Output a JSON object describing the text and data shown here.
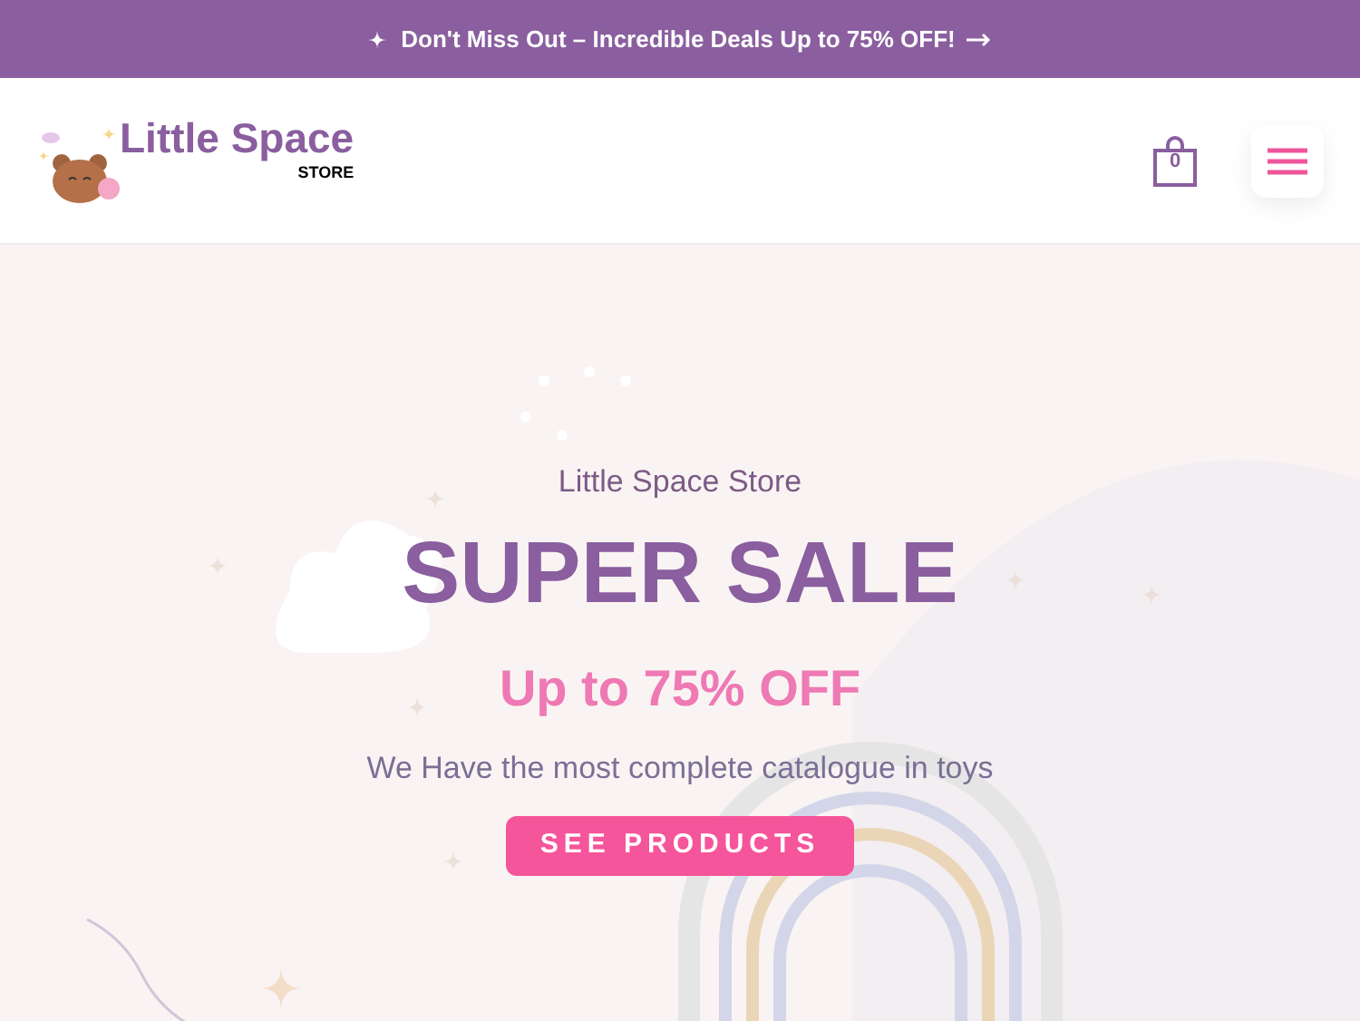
{
  "promo_banner": {
    "text": "Don't Miss Out – Incredible Deals Up to 75% OFF!"
  },
  "header": {
    "logo": {
      "name": "Little Space",
      "tagline": "STORE"
    },
    "cart": {
      "count": "0"
    }
  },
  "hero": {
    "eyebrow": "Little Space Store",
    "title": "SUPER SALE",
    "subtitle": "Up to 75% OFF",
    "description": "We Have the most complete catalogue in toys",
    "button": "SEE PRODUCTS"
  }
}
